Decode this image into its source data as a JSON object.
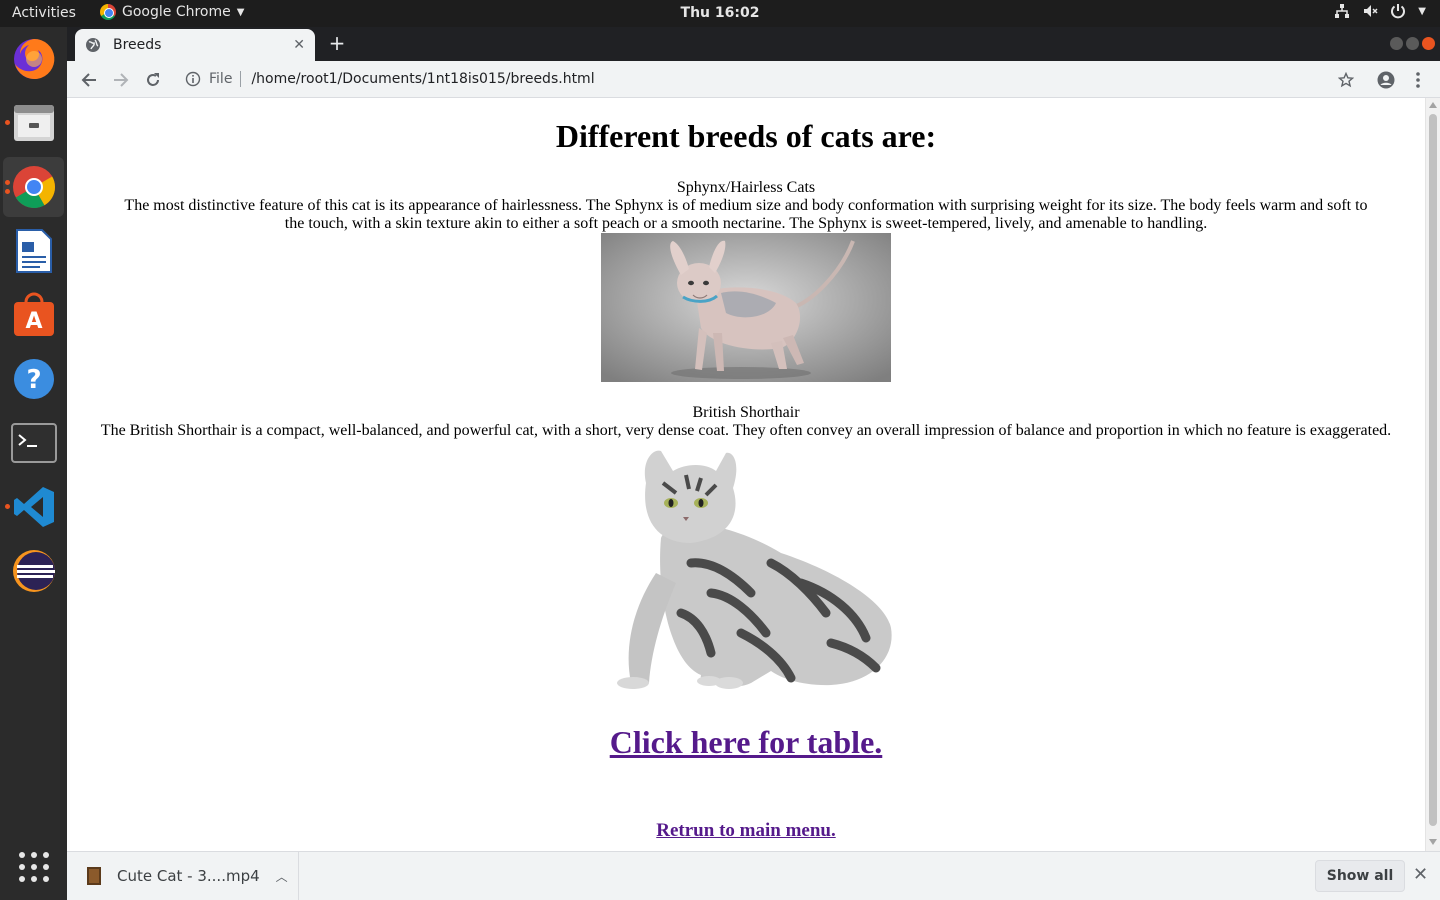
{
  "topbar": {
    "activities": "Activities",
    "app_name": "Google Chrome",
    "clock": "Thu 16:02"
  },
  "dock": {
    "items": [
      "firefox-icon",
      "files-icon",
      "chrome-icon",
      "libreoffice-writer-icon",
      "software-center-icon",
      "help-icon",
      "terminal-icon",
      "vscode-icon",
      "eclipse-icon",
      "app-grid-icon"
    ]
  },
  "browser": {
    "tab_title": "Breeds",
    "scheme_label": "File",
    "url": "/home/root1/Documents/1nt18is015/breeds.html"
  },
  "page": {
    "heading": "Different breeds of cats are:",
    "breeds": [
      {
        "name": "Sphynx/Hairless Cats",
        "description": "The most distinctive feature of this cat is its appearance of hairlessness. The Sphynx is of medium size and body conformation with surprising weight for its size. The body feels warm and soft to the touch, with a skin texture akin to either a soft peach or a smooth nectarine. The Sphynx is sweet-tempered, lively, and amenable to handling."
      },
      {
        "name": "British Shorthair",
        "description": "The British Shorthair is a compact, well-balanced, and powerful cat, with a short, very dense coat. They often convey an overall impression of balance and proportion in which no feature is exaggerated."
      }
    ],
    "table_link": "Click here for table.",
    "main_menu_link": "Retrun to main menu."
  },
  "downloads": {
    "file_name": "Cute Cat - 3....mp4",
    "show_all": "Show all"
  }
}
